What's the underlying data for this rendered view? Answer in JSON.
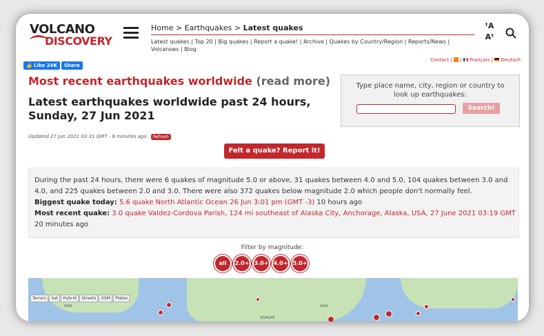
{
  "logo": {
    "line1": "VOLCANO",
    "line2": "DISCOVERY"
  },
  "breadcrumb": {
    "home": "Home",
    "sep1": ">",
    "section": "Earthquakes",
    "sep2": ">",
    "current": "Latest quakes"
  },
  "nav_links": "Latest quakes | Top 20 | Big quakes | Report a quake! | Archive | Quakes by Country/Region | Reports/News | Volcanoes | Blog",
  "text_size": {
    "up": "ᵗA",
    "down": "Aᵗ"
  },
  "social": {
    "like": "Like 24K",
    "share": "Share"
  },
  "top_links": {
    "contact": "Contact",
    "sep": "|",
    "french": "Français",
    "german": "Deutsch"
  },
  "heading": {
    "main": "Most recent earthquakes worldwide",
    "read_more": "(read more)"
  },
  "subheading": "Latest earthquakes worldwide past 24 hours, Sunday, 27 Jun 2021",
  "search_box": {
    "text": "Type place name, city, region or country to look up earthquakes:",
    "button": "Search!",
    "input_value": ""
  },
  "updated": "Updated 27 Jun 2021 03:31 GMT - 8 minutes ago",
  "refresh": "Refresh",
  "felt_button": "Felt a quake? Report it!",
  "summary": {
    "text": "During the past 24 hours, there were 6 quakes of magnitude 5.0 or above, 31 quakes between 4.0 and 5.0, 104 quakes between 3.0 and 4.0, and 225 quakes between 2.0 and 3.0. There were also 372 quakes below magnitude 2.0 which people don't normally feel.",
    "biggest_label": "Biggest quake today:",
    "biggest_link": "5.6 quake North Atlantic Ocean 26 Jun 3:01 pm (GMT -3)",
    "biggest_tail": "10 hours ago",
    "recent_label": "Most recent quake:",
    "recent_link": "3.0 quake Valdez-Cordova Parish, 124 mi southeast of Alaska City, Anchorage, Alaska, USA, 27 June 2021 03:19 GMT",
    "recent_tail": "20 minutes ago"
  },
  "filter": {
    "label": "Filter by magnitude:",
    "options": [
      "all",
      "2.0+",
      "3.0+",
      "4.0+",
      "5.0+"
    ]
  },
  "map": {
    "buttons": [
      "Terrain",
      "Sat",
      "Hybrid",
      "Streets",
      "OSM",
      "Plates"
    ],
    "labels": [
      "ASIA",
      "ASIA",
      "EUROPE"
    ]
  },
  "colors": {
    "brand_red": "#c1272d",
    "facebook_blue": "#1877f2",
    "map_water": "#9fc4e8",
    "map_land": "#c7e2b6"
  }
}
